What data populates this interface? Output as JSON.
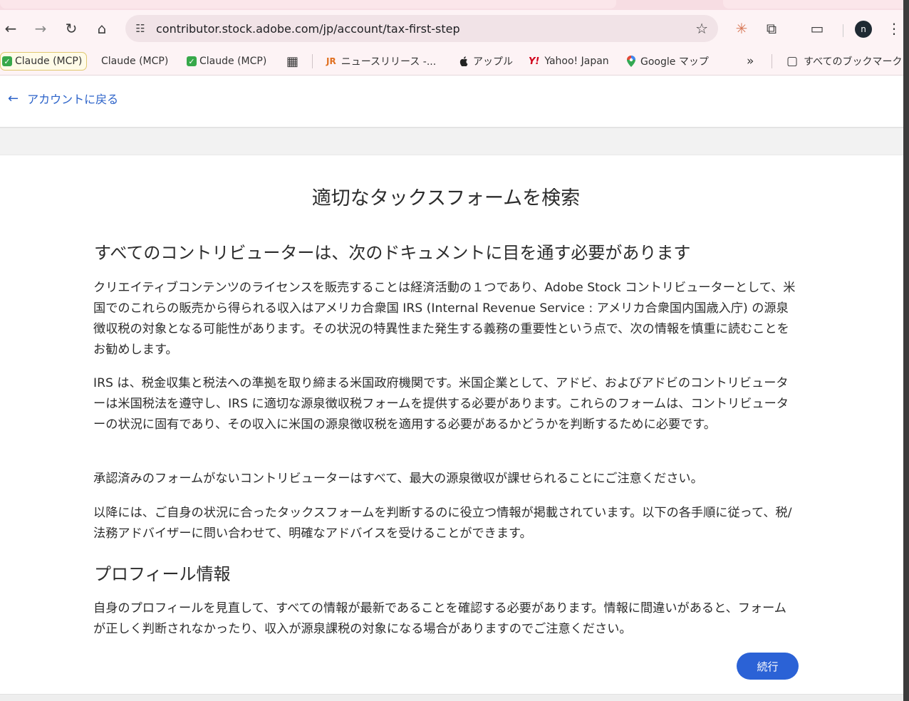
{
  "browser": {
    "url": "contributor.stock.adobe.com/jp/account/tax-first-step",
    "avatar_letter": "n",
    "icons": {
      "back": "←",
      "forward": "→",
      "reload": "↻",
      "home": "⌂",
      "tune": "☷",
      "star": "☆",
      "claude": "✳",
      "extensions": "⧉",
      "cast": "▭",
      "menu": "⋮",
      "overflow": "»",
      "folder": "▢"
    }
  },
  "bookmarks": {
    "items": [
      {
        "label": "Claude (MCP)",
        "checked": true
      },
      {
        "label": "Claude (MCP)",
        "checked": false
      },
      {
        "label": "Claude (MCP)",
        "checked": true
      },
      {
        "label": "ニュースリリース -...",
        "icon": "JR"
      },
      {
        "label": "アップル",
        "icon": ""
      },
      {
        "label": "Yahoo! Japan",
        "icon": "Y!"
      },
      {
        "label": "Google マップ",
        "icon": "📍"
      }
    ],
    "apps_icon": "▦",
    "all_bookmarks": "すべてのブックマーク"
  },
  "page": {
    "back_link": "アカウントに戻る",
    "back_arrow": "←",
    "title": "適切なタックスフォームを検索",
    "section1_heading": "すべてのコントリビューターは、次のドキュメントに目を通す必要があります",
    "paragraphs": [
      "クリエイティブコンテンツのライセンスを販売することは経済活動の１つであり、Adobe Stock コントリビューターとして、米国でのこれらの販売から得られる収入はアメリカ合衆国 IRS (Internal Revenue Service : アメリカ合衆国内国歳入庁) の源泉徴収税の対象となる可能性があります。その状況の特異性また発生する義務の重要性という点で、次の情報を慎重に読むことをお勧めします。",
      "IRS は、税金収集と税法への準拠を取り締まる米国政府機関です。米国企業として、アドビ、およびアドビのコントリビューターは米国税法を遵守し、IRS に適切な源泉徴収税フォームを提供する必要があります。これらのフォームは、コントリビューターの状況に固有であり、その収入に米国の源泉徴収税を適用する必要があるかどうかを判断するために必要です。",
      "承認済みのフォームがないコントリビューターはすべて、最大の源泉徴収が課せられることにご注意ください。",
      "以降には、ご自身の状況に合ったタックスフォームを判断するのに役立つ情報が掲載されています。以下の各手順に従って、税/法務アドバイザーに問い合わせて、明確なアドバイスを受けることができます。"
    ],
    "section2_heading": "プロフィール情報",
    "profile_paragraph": "自身のプロフィールを見直して、すべての情報が最新であることを確認する必要があります。情報に間違いがあると、フォームが正しく判断されなかったり、収入が源泉課税の対象になる場合がありますのでご注意ください。",
    "continue_button": "続行"
  },
  "colors": {
    "accent": "#2b62d6",
    "link": "#2b62c9",
    "text": "#2c2c2c"
  }
}
